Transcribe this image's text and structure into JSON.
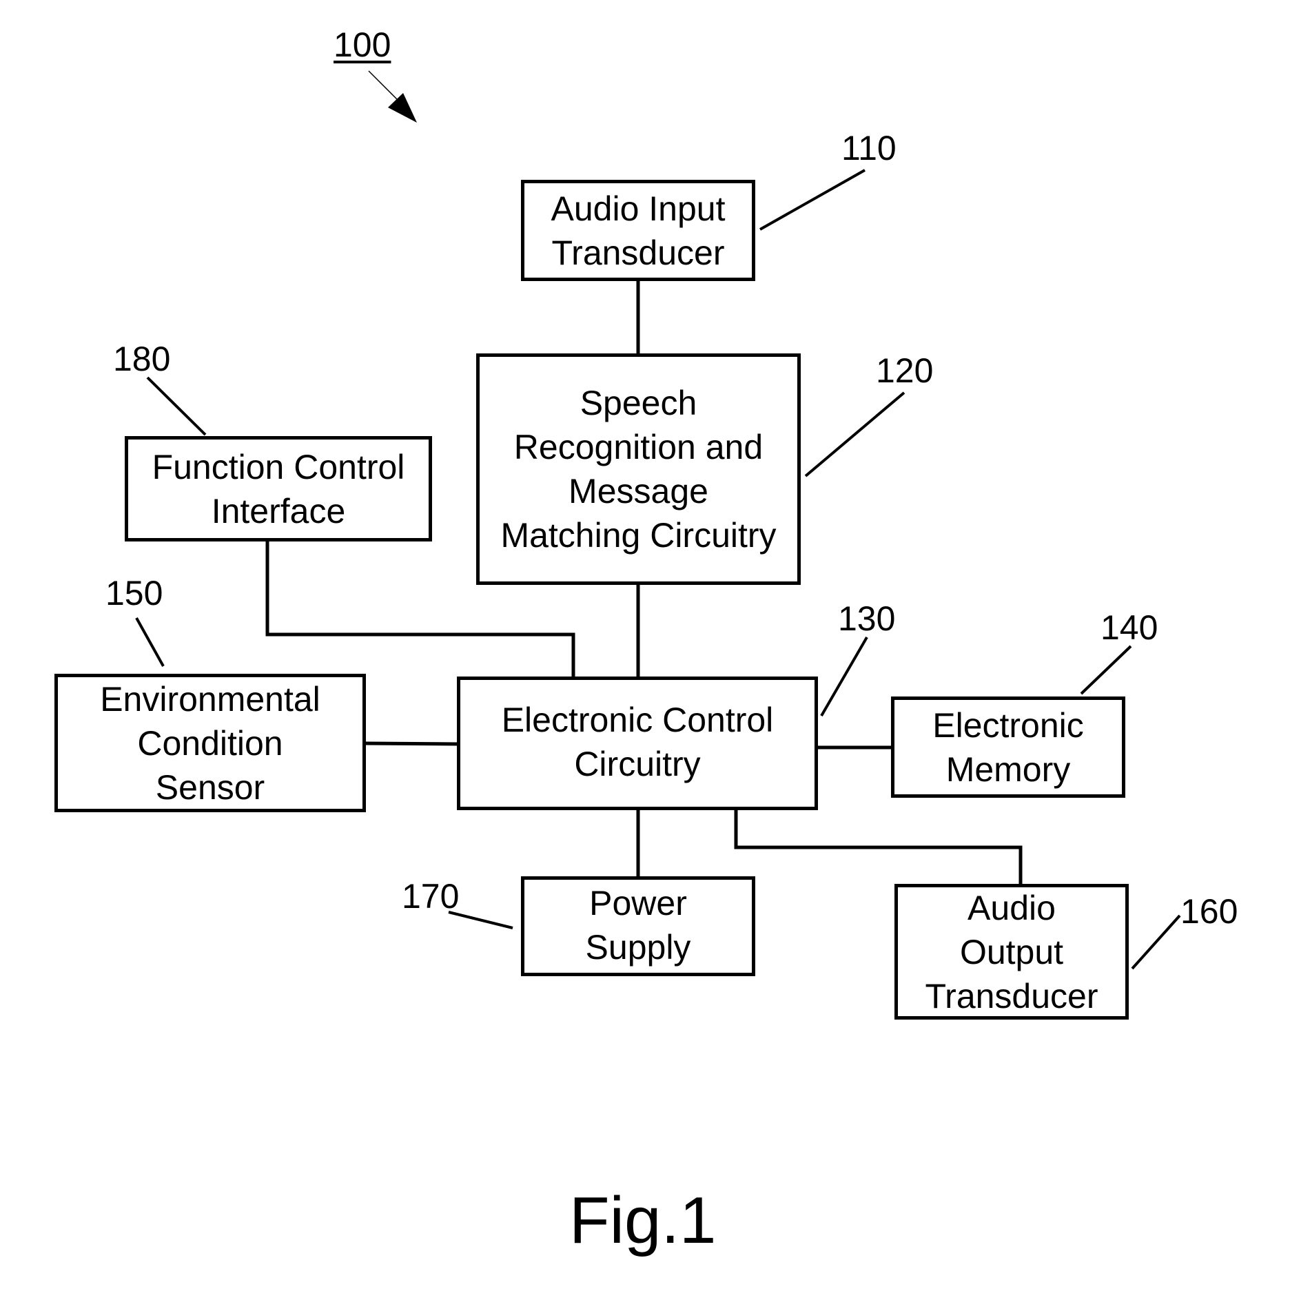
{
  "figure": {
    "caption": "Fig.1",
    "reference": "100"
  },
  "blocks": {
    "audio_input": {
      "ref": "110",
      "lines": [
        "Audio Input",
        "Transducer"
      ]
    },
    "speech": {
      "ref": "120",
      "lines": [
        "Speech",
        "Recognition and",
        "Message",
        "Matching Circuitry"
      ]
    },
    "control": {
      "ref": "130",
      "lines": [
        "Electronic Control",
        "Circuitry"
      ]
    },
    "memory": {
      "ref": "140",
      "lines": [
        "Electronic",
        "Memory"
      ]
    },
    "sensor": {
      "ref": "150",
      "lines": [
        "Environmental",
        "Condition",
        "Sensor"
      ]
    },
    "audio_output": {
      "ref": "160",
      "lines": [
        "Audio",
        "Output",
        "Transducer"
      ]
    },
    "power": {
      "ref": "170",
      "lines": [
        "Power",
        "Supply"
      ]
    },
    "function_control": {
      "ref": "180",
      "lines": [
        "Function Control",
        "Interface"
      ]
    }
  },
  "connections": [
    {
      "from": "audio_input",
      "to": "speech"
    },
    {
      "from": "speech",
      "to": "control"
    },
    {
      "from": "function_control",
      "to": "control"
    },
    {
      "from": "sensor",
      "to": "control"
    },
    {
      "from": "control",
      "to": "memory"
    },
    {
      "from": "control",
      "to": "power"
    },
    {
      "from": "control",
      "to": "audio_output"
    }
  ]
}
